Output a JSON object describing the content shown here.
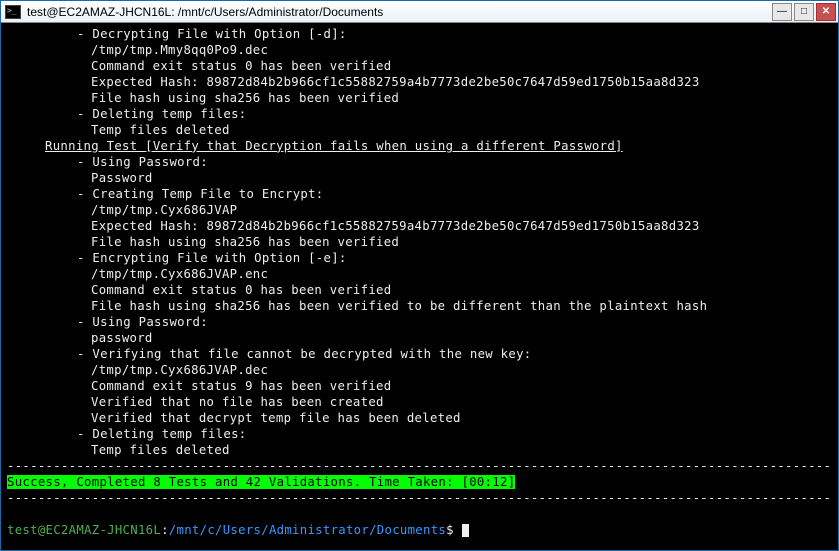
{
  "window": {
    "title": "test@EC2AMAZ-JHCN16L: /mnt/c/Users/Administrator/Documents"
  },
  "t": {
    "l1": "- Decrypting File with Option [-d]:",
    "l2": "/tmp/tmp.Mmy8qq0Po9.dec",
    "l3": "Command exit status 0 has been verified",
    "l4": "Expected Hash: 89872d84b2b966cf1c55882759a4b7773de2be50c7647d59ed1750b15aa8d323",
    "l5": "File hash using sha256 has been verified",
    "l6": "- Deleting temp files:",
    "l7": "Temp files deleted",
    "l8": "Running Test [Verify that Decryption fails when using a different Password]",
    "l9": "- Using Password:",
    "l10": "Password",
    "l11": "- Creating Temp File to Encrypt:",
    "l12": "/tmp/tmp.Cyx686JVAP",
    "l13": "Expected Hash: 89872d84b2b966cf1c55882759a4b7773de2be50c7647d59ed1750b15aa8d323",
    "l14": "File hash using sha256 has been verified",
    "l15": "- Encrypting File with Option [-e]:",
    "l16": "/tmp/tmp.Cyx686JVAP.enc",
    "l17": "Command exit status 0 has been verified",
    "l18": "File hash using sha256 has been verified to be different than the plaintext hash",
    "l19": "- Using Password:",
    "l20": "password",
    "l21": "- Verifying that file cannot be decrypted with the new key:",
    "l22": "/tmp/tmp.Cyx686JVAP.dec",
    "l23": "Command exit status 9 has been verified",
    "l24": "Verified that no file has been created",
    "l25": "Verified that decrypt temp file has been deleted",
    "l26": "- Deleting temp files:",
    "l27": "Temp files deleted",
    "dash": "--------------------------------------------------------------------------------------------------------------",
    "success": "Success, Completed 8 Tests and 42 Validations. Time Taken: [00:12]"
  },
  "prompt": {
    "user": "test@EC2AMAZ-JHCN16L",
    "sep": ":",
    "path": "/mnt/c/Users/Administrator/Documents",
    "sym": "$"
  }
}
